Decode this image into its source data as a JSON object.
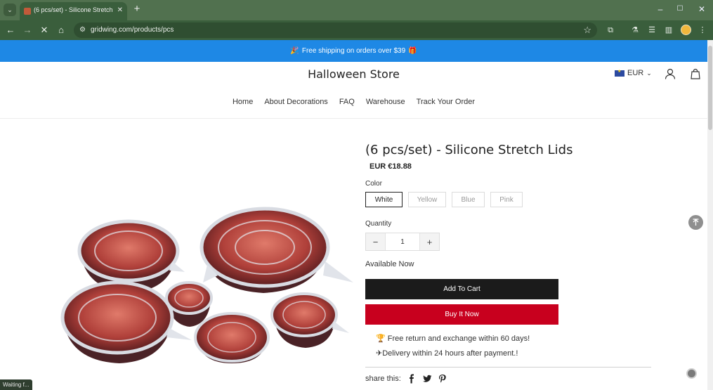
{
  "browser": {
    "tab_title": "(6 pcs/set) - Silicone Stretch Lids",
    "url": "gridwing.com/products/pcs",
    "status_text": "Waiting f...",
    "icons": [
      "tab-search-icon",
      "close-icon",
      "plus-icon",
      "minimize-icon",
      "maximize-icon",
      "window-close-icon",
      "back-icon",
      "forward-icon",
      "stop-icon",
      "home-icon",
      "site-info-icon",
      "bookmark-star-icon",
      "extensions-icon",
      "labs-icon",
      "reading-list-icon",
      "side-panel-icon",
      "profile-icon",
      "more-menu-icon"
    ]
  },
  "announcement": {
    "text": "Free shipping on orders over $39",
    "emoji_left": "🎉",
    "emoji_right": "🎁"
  },
  "header": {
    "store_name": "Halloween Store",
    "currency": "EUR",
    "nav": [
      "Home",
      "About Decorations",
      "FAQ",
      "Warehouse",
      "Track Your Order"
    ]
  },
  "product": {
    "title": "(6 pcs/set) - Silicone Stretch Lids",
    "price": "EUR €18.88",
    "color_label": "Color",
    "colors": [
      "White",
      "Yellow",
      "Blue",
      "Pink"
    ],
    "selected_color": "White",
    "quantity_label": "Quantity",
    "quantity": "1",
    "availability": "Available Now",
    "add_to_cart": "Add To Cart",
    "buy_now": "Buy It Now",
    "perks": [
      {
        "icon": "🏆",
        "text": "Free return and exchange within 60 days!"
      },
      {
        "icon": "✈",
        "text": "Delivery within 24 hours after payment.!"
      }
    ],
    "share_label": "share this:"
  },
  "colors": {
    "announcement_bar": "#1e88e5",
    "buy_now": "#c8001e",
    "add_to_cart": "#1b1b1b",
    "chrome": "#3a5e3c"
  }
}
